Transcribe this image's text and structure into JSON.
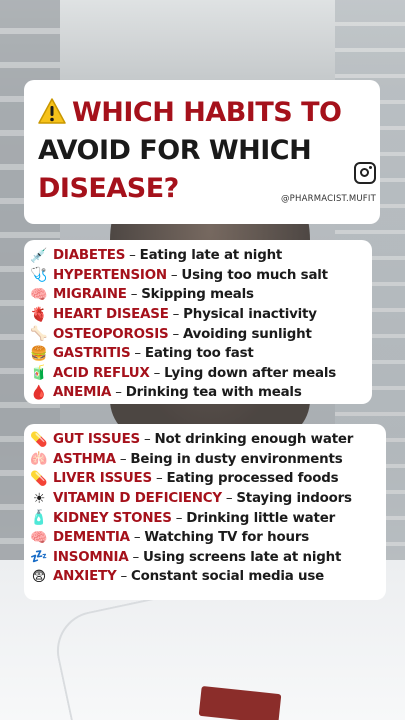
{
  "title": {
    "line1_red": "WHICH HABITS TO",
    "line2": "AVOID FOR WHICH",
    "line3_red": "DISEASE?",
    "warning_icon": "warning-icon",
    "instagram_icon": "instagram-icon",
    "handle": "@PHARMACIST.MUFIT"
  },
  "colors": {
    "accent": "#a5111b",
    "text": "#1b1b1b",
    "card": "#ffffff"
  },
  "list1": [
    {
      "icon": "syringe-icon",
      "glyph": "💉",
      "disease": "DIABETES",
      "habit": "Eating late at night"
    },
    {
      "icon": "stethoscope-icon",
      "glyph": "🩺",
      "disease": "HYPERTENSION",
      "habit": "Using too much salt"
    },
    {
      "icon": "brain-icon",
      "glyph": "🧠",
      "disease": "MIGRAINE",
      "habit": "Skipping meals"
    },
    {
      "icon": "heart-icon",
      "glyph": "🫀",
      "disease": "HEART DISEASE",
      "habit": "Physical inactivity"
    },
    {
      "icon": "bone-icon",
      "glyph": "🦴",
      "disease": "OSTEOPOROSIS",
      "habit": "Avoiding sunlight"
    },
    {
      "icon": "burger-icon",
      "glyph": "🍔",
      "disease": "GASTRITIS",
      "habit": "Eating too fast"
    },
    {
      "icon": "antacid-icon",
      "glyph": "🧃",
      "disease": "ACID REFLUX",
      "habit": "Lying down after meals"
    },
    {
      "icon": "blood-drop-icon",
      "glyph": "🩸",
      "disease": "ANEMIA",
      "habit": "Drinking tea with meals"
    }
  ],
  "list2": [
    {
      "icon": "pill-icon",
      "glyph": "💊",
      "disease": "GUT ISSUES",
      "habit": "Not drinking enough water"
    },
    {
      "icon": "lungs-icon",
      "glyph": "🫁",
      "disease": "ASTHMA",
      "habit": "Being in dusty environments"
    },
    {
      "icon": "capsule-icon",
      "glyph": "💊",
      "disease": "LIVER ISSUES",
      "habit": "Eating processed foods"
    },
    {
      "icon": "sun-icon",
      "glyph": "☀",
      "disease": "VITAMIN D DEFICIENCY",
      "habit": "Staying indoors"
    },
    {
      "icon": "water-bottle-icon",
      "glyph": "🧴",
      "disease": "KIDNEY STONES",
      "habit": "Drinking little water"
    },
    {
      "icon": "brain-icon",
      "glyph": "🧠",
      "disease": "DEMENTIA",
      "habit": "Watching TV for hours"
    },
    {
      "icon": "sleep-icon",
      "glyph": "💤",
      "disease": "INSOMNIA",
      "habit": "Using screens late at night"
    },
    {
      "icon": "anxious-face-icon",
      "glyph": "😨",
      "disease": "ANXIETY",
      "habit": "Constant social media use"
    }
  ],
  "separator": "–"
}
